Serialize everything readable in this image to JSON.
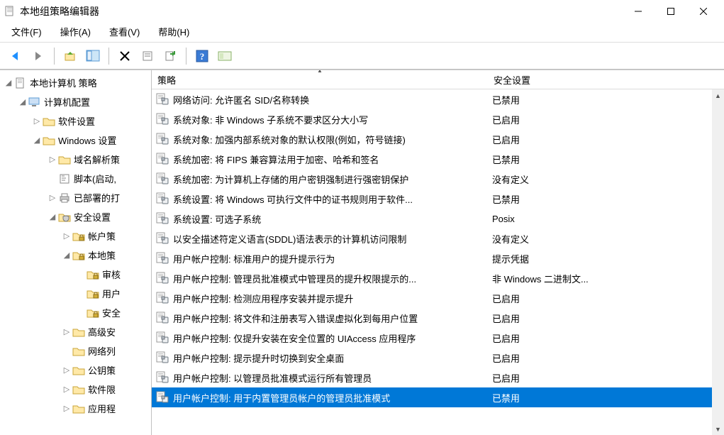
{
  "window": {
    "title": "本地组策略编辑器"
  },
  "menu": {
    "file": "文件(F)",
    "action": "操作(A)",
    "view": "查看(V)",
    "help": "帮助(H)"
  },
  "columns": {
    "policy": "策略",
    "setting": "安全设置"
  },
  "tree": [
    {
      "level": 0,
      "label": "本地计算机 策略",
      "icon": "doc",
      "exp": "open"
    },
    {
      "level": 1,
      "label": "计算机配置",
      "icon": "computer",
      "exp": "open"
    },
    {
      "level": 2,
      "label": "软件设置",
      "icon": "folder",
      "exp": "closed"
    },
    {
      "level": 2,
      "label": "Windows 设置",
      "icon": "folder",
      "exp": "open"
    },
    {
      "level": 3,
      "label": "域名解析策",
      "icon": "folder",
      "exp": "closed"
    },
    {
      "level": 3,
      "label": "脚本(启动,",
      "icon": "script",
      "exp": "none"
    },
    {
      "level": 3,
      "label": "已部署的打",
      "icon": "printer",
      "exp": "closed"
    },
    {
      "level": 3,
      "label": "安全设置",
      "icon": "shield",
      "exp": "open"
    },
    {
      "level": 4,
      "label": "帐户策",
      "icon": "folder-lock",
      "exp": "closed"
    },
    {
      "level": 4,
      "label": "本地策",
      "icon": "folder-lock",
      "exp": "open"
    },
    {
      "level": 5,
      "label": "审核",
      "icon": "folder-lock",
      "exp": "none"
    },
    {
      "level": 5,
      "label": "用户",
      "icon": "folder-lock",
      "exp": "none"
    },
    {
      "level": 5,
      "label": "安全",
      "icon": "folder-lock",
      "exp": "none"
    },
    {
      "level": 4,
      "label": "高级安",
      "icon": "folder",
      "exp": "closed"
    },
    {
      "level": 4,
      "label": "网络列",
      "icon": "folder",
      "exp": "none"
    },
    {
      "level": 4,
      "label": "公钥策",
      "icon": "folder",
      "exp": "closed"
    },
    {
      "level": 4,
      "label": "软件限",
      "icon": "folder",
      "exp": "closed"
    },
    {
      "level": 4,
      "label": "应用程",
      "icon": "folder",
      "exp": "closed"
    }
  ],
  "policies": [
    {
      "name": "网络访问: 允许匿名 SID/名称转换",
      "value": "已禁用",
      "selected": false
    },
    {
      "name": "系统对象: 非 Windows 子系统不要求区分大小写",
      "value": "已启用",
      "selected": false
    },
    {
      "name": "系统对象: 加强内部系统对象的默认权限(例如，符号链接)",
      "value": "已启用",
      "selected": false
    },
    {
      "name": "系统加密: 将 FIPS 兼容算法用于加密、哈希和签名",
      "value": "已禁用",
      "selected": false
    },
    {
      "name": "系统加密: 为计算机上存储的用户密钥强制进行强密钥保护",
      "value": "没有定义",
      "selected": false
    },
    {
      "name": "系统设置: 将 Windows 可执行文件中的证书规则用于软件...",
      "value": "已禁用",
      "selected": false
    },
    {
      "name": "系统设置: 可选子系统",
      "value": "Posix",
      "selected": false
    },
    {
      "name": "以安全描述符定义语言(SDDL)语法表示的计算机访问限制",
      "value": "没有定义",
      "selected": false
    },
    {
      "name": "用户帐户控制: 标准用户的提升提示行为",
      "value": "提示凭据",
      "selected": false
    },
    {
      "name": "用户帐户控制: 管理员批准模式中管理员的提升权限提示的...",
      "value": "非 Windows 二进制文...",
      "selected": false
    },
    {
      "name": "用户帐户控制: 检测应用程序安装并提示提升",
      "value": "已启用",
      "selected": false
    },
    {
      "name": "用户帐户控制: 将文件和注册表写入错误虚拟化到每用户位置",
      "value": "已启用",
      "selected": false
    },
    {
      "name": "用户帐户控制: 仅提升安装在安全位置的 UIAccess 应用程序",
      "value": "已启用",
      "selected": false
    },
    {
      "name": "用户帐户控制: 提示提升时切换到安全桌面",
      "value": "已启用",
      "selected": false
    },
    {
      "name": "用户帐户控制: 以管理员批准模式运行所有管理员",
      "value": "已启用",
      "selected": false
    },
    {
      "name": "用户帐户控制: 用于内置管理员帐户的管理员批准模式",
      "value": "已禁用",
      "selected": true
    }
  ]
}
